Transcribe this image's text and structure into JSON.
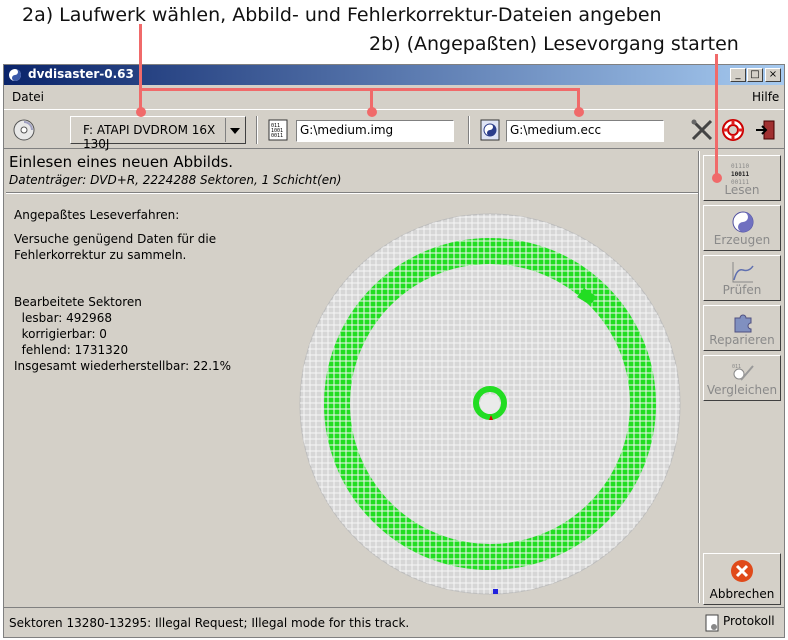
{
  "annotations": {
    "line1": "2a) Laufwerk wählen, Abbild- und Fehlerkorrektur-Dateien angeben",
    "line2": "2b) (Angepaßten) Lesevorgang starten"
  },
  "window": {
    "title": "dvdisaster-0.63"
  },
  "window_controls": {
    "minimize": "_",
    "maximize": "□",
    "close": "×"
  },
  "menu": {
    "left": "Datei",
    "right": "Hilfe"
  },
  "toolbar": {
    "drive": "F: ATAPI DVDROM 16X 130J",
    "image_file": "G:\\medium.img",
    "ecc_file": "G:\\medium.ecc"
  },
  "header": {
    "title": "Einlesen eines neuen Abbilds.",
    "subtitle": "Datenträger: DVD+R, 2224288 Sektoren, 1 Schicht(en)"
  },
  "info": {
    "mode": "Angepaßtes Leseverfahren:",
    "line1": "Versuche genügend Daten für die",
    "line2": "Fehlerkorrektur zu sammeln.",
    "sectors_title": "Bearbeitete Sektoren",
    "readable": "  lesbar: 492968",
    "correctable": "  korrigierbar: 0",
    "missing": "  fehlend: 1731320",
    "total": "Insgesamt wiederherstellbar: 22.1%"
  },
  "sidebar": {
    "read": "Lesen",
    "create": "Erzeugen",
    "verify": "Prüfen",
    "repair": "Reparieren",
    "compare": "Vergleichen",
    "abort": "Abbrechen"
  },
  "status": {
    "message": "Sektoren 13280-13295: Illegal Request; Illegal mode for this track.",
    "log": "Protokoll"
  },
  "colors": {
    "read_ok": "#22dd22",
    "unread": "#d6d6d6",
    "title_blue": "#0a246a",
    "annotation": "#f06a6a"
  }
}
